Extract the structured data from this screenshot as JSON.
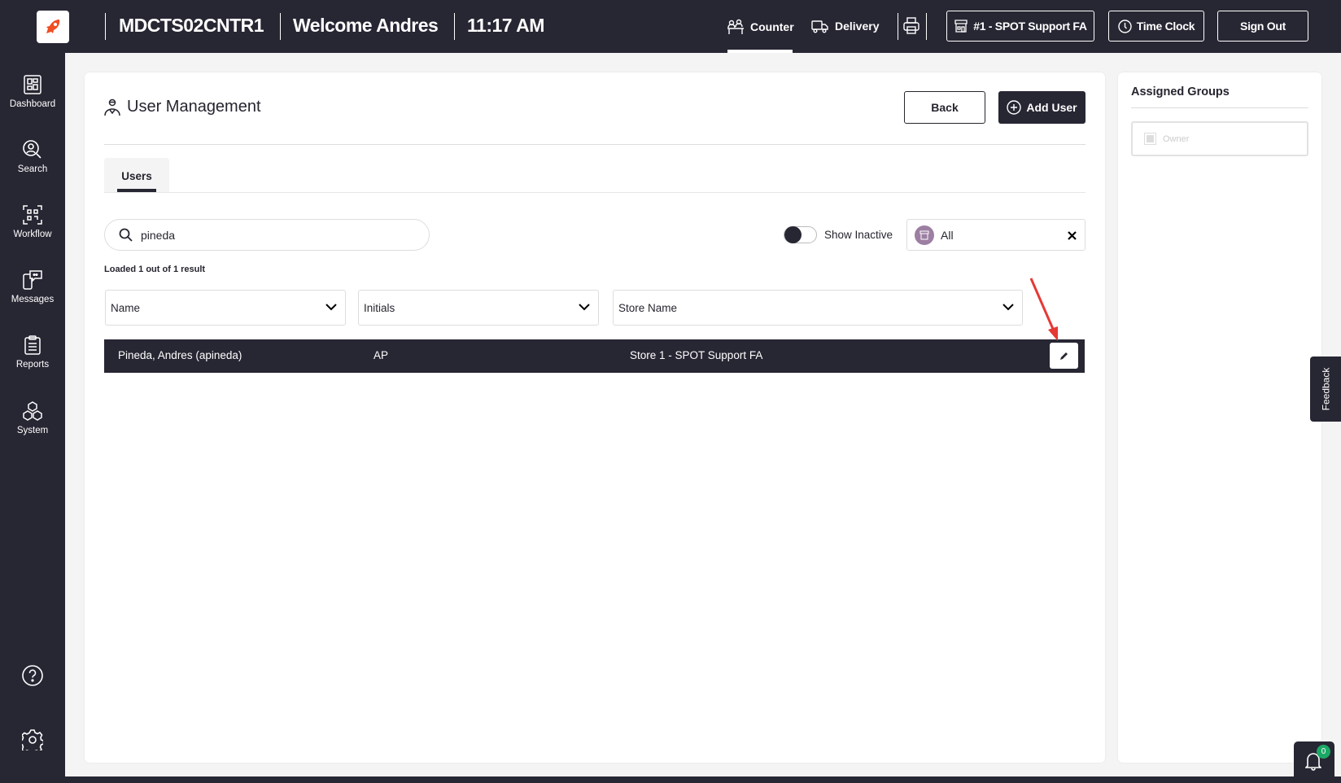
{
  "topbar": {
    "terminal": "MDCTS02CNTR1",
    "welcome": "Welcome Andres",
    "time": "11:17 AM",
    "nav": [
      {
        "label": "Counter",
        "icon": "counter-icon",
        "active": true
      },
      {
        "label": "Delivery",
        "icon": "delivery-truck-icon"
      }
    ],
    "store_button": "#1 - SPOT Support FA",
    "time_clock": "Time Clock",
    "sign_out": "Sign Out"
  },
  "sidebar": {
    "items": [
      {
        "label": "Dashboard",
        "icon": "dashboard-icon"
      },
      {
        "label": "Search",
        "icon": "search-user-icon"
      },
      {
        "label": "Workflow",
        "icon": "qr-scan-icon"
      },
      {
        "label": "Messages",
        "icon": "messages-icon"
      },
      {
        "label": "Reports",
        "icon": "clipboard-icon"
      },
      {
        "label": "System",
        "icon": "cubes-icon"
      }
    ],
    "bottom_icons": [
      "help-icon",
      "settings-gear-icon"
    ]
  },
  "main": {
    "title": "User Management",
    "back": "Back",
    "add_user": "Add User",
    "tabs": [
      {
        "label": "Users",
        "active": true
      }
    ],
    "search": {
      "value": "pineda",
      "placeholder": ""
    },
    "show_inactive": {
      "label": "Show Inactive",
      "on": false
    },
    "store_filter": "All",
    "result_count": "Loaded 1 out of 1 result",
    "columns": [
      "Name",
      "Initials",
      "Store Name"
    ],
    "rows": [
      {
        "name": "Pineda, Andres (apineda)",
        "initials": "AP",
        "store": "Store 1 - SPOT Support FA"
      }
    ]
  },
  "assigned_groups": {
    "title": "Assigned Groups",
    "groups": [
      {
        "label": "Owner",
        "checked": false,
        "disabled": true
      }
    ]
  },
  "feedback": "Feedback",
  "notifications": {
    "count": "0"
  },
  "colors": {
    "dark": "#272633",
    "accent_logo": "#f04e23",
    "annotation_arrow": "#e53935",
    "badge": "#1aa865"
  }
}
